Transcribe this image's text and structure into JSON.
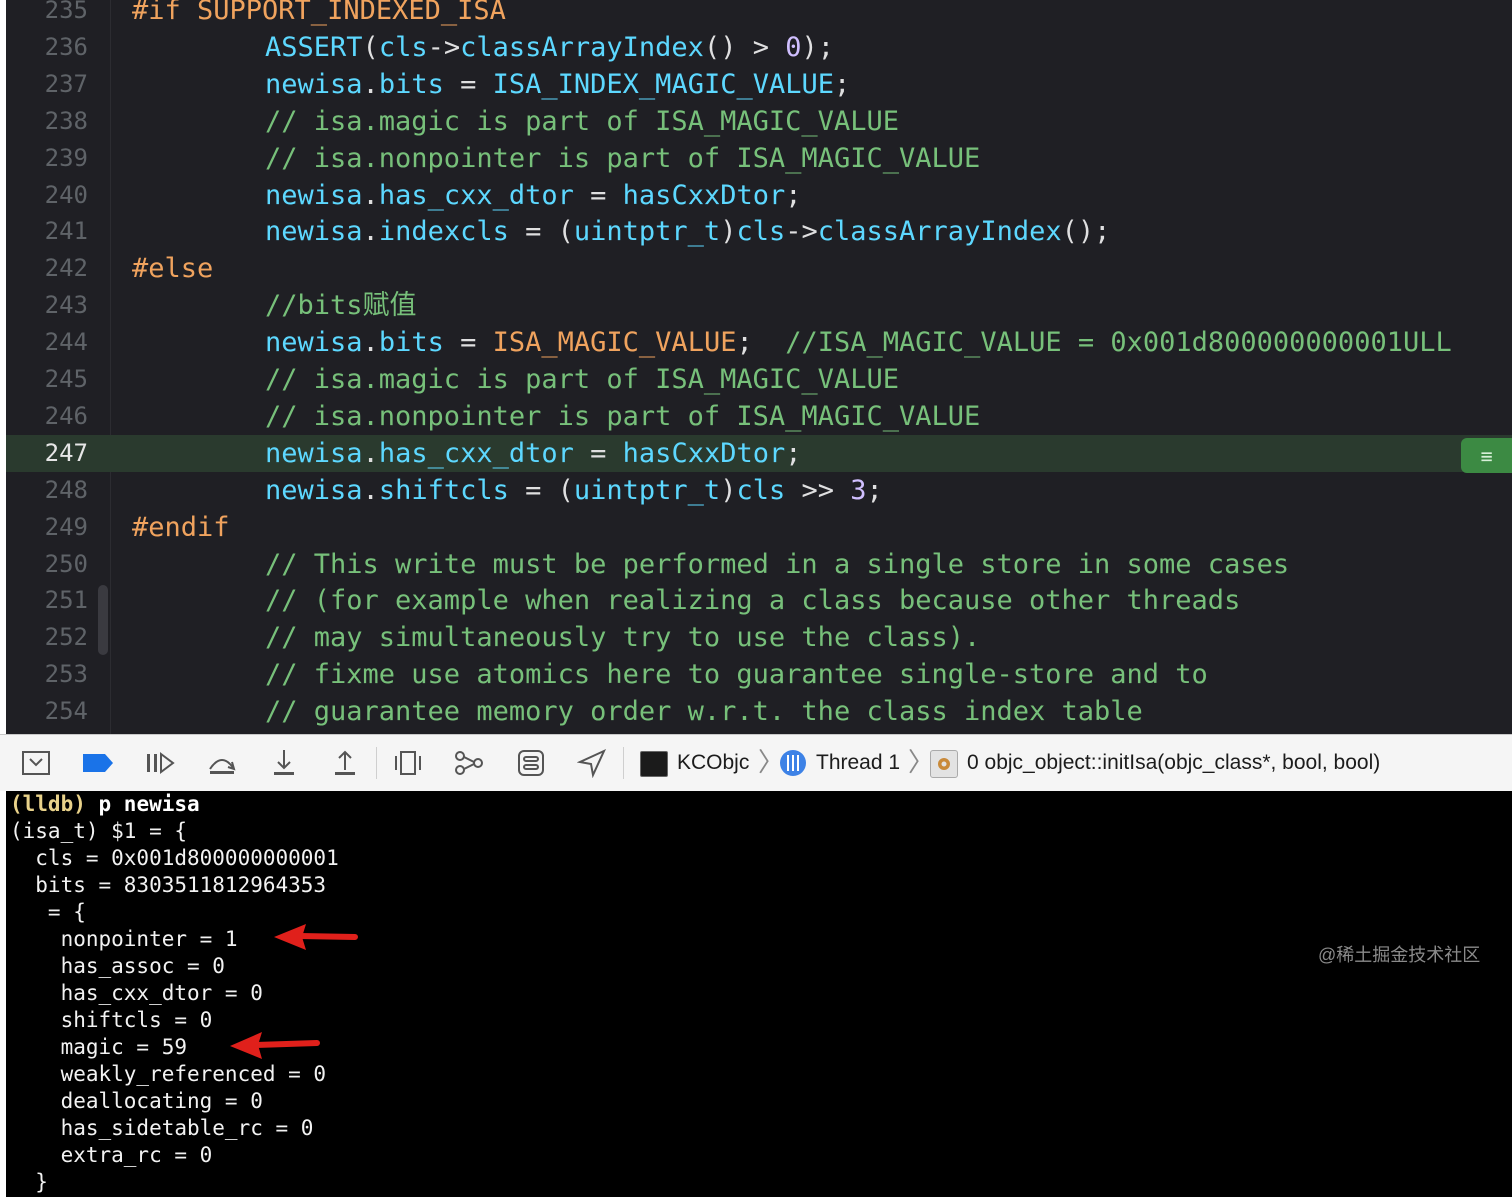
{
  "editor": {
    "lines": [
      {
        "n": "235",
        "segments": [
          {
            "t": "#if SUPPORT_INDEXED_ISA",
            "c": "pp"
          }
        ],
        "indent": 0
      },
      {
        "n": "236",
        "segments": [
          {
            "t": "ASSERT",
            "c": "id"
          },
          {
            "t": "(",
            "c": "op"
          },
          {
            "t": "cls",
            "c": "id"
          },
          {
            "t": "->",
            "c": "op"
          },
          {
            "t": "classArrayIndex",
            "c": "id"
          },
          {
            "t": "() > ",
            "c": "op"
          },
          {
            "t": "0",
            "c": "num"
          },
          {
            "t": ");",
            "c": "op"
          }
        ],
        "indent": 1
      },
      {
        "n": "237",
        "segments": [
          {
            "t": "newisa",
            "c": "id"
          },
          {
            "t": ".",
            "c": "op"
          },
          {
            "t": "bits",
            "c": "id"
          },
          {
            "t": " = ",
            "c": "op"
          },
          {
            "t": "ISA_INDEX_MAGIC_VALUE",
            "c": "id"
          },
          {
            "t": ";",
            "c": "op"
          }
        ],
        "indent": 1
      },
      {
        "n": "238",
        "segments": [
          {
            "t": "// isa.magic is part of ISA_MAGIC_VALUE",
            "c": "cm"
          }
        ],
        "indent": 1
      },
      {
        "n": "239",
        "segments": [
          {
            "t": "// isa.nonpointer is part of ISA_MAGIC_VALUE",
            "c": "cm"
          }
        ],
        "indent": 1
      },
      {
        "n": "240",
        "segments": [
          {
            "t": "newisa",
            "c": "id"
          },
          {
            "t": ".",
            "c": "op"
          },
          {
            "t": "has_cxx_dtor",
            "c": "id"
          },
          {
            "t": " = ",
            "c": "op"
          },
          {
            "t": "hasCxxDtor",
            "c": "id"
          },
          {
            "t": ";",
            "c": "op"
          }
        ],
        "indent": 1
      },
      {
        "n": "241",
        "segments": [
          {
            "t": "newisa",
            "c": "id"
          },
          {
            "t": ".",
            "c": "op"
          },
          {
            "t": "indexcls",
            "c": "id"
          },
          {
            "t": " = (",
            "c": "op"
          },
          {
            "t": "uintptr_t",
            "c": "id"
          },
          {
            "t": ")",
            "c": "op"
          },
          {
            "t": "cls",
            "c": "id"
          },
          {
            "t": "->",
            "c": "op"
          },
          {
            "t": "classArrayIndex",
            "c": "id"
          },
          {
            "t": "();",
            "c": "op"
          }
        ],
        "indent": 1
      },
      {
        "n": "242",
        "segments": [
          {
            "t": "#else",
            "c": "pp"
          }
        ],
        "indent": 0
      },
      {
        "n": "243",
        "segments": [
          {
            "t": "//bits赋值",
            "c": "cm"
          }
        ],
        "indent": 1
      },
      {
        "n": "244",
        "segments": [
          {
            "t": "newisa",
            "c": "id"
          },
          {
            "t": ".",
            "c": "op"
          },
          {
            "t": "bits",
            "c": "id"
          },
          {
            "t": " = ",
            "c": "op"
          },
          {
            "t": "ISA_MAGIC_VALUE",
            "c": "mac"
          },
          {
            "t": ";  ",
            "c": "op"
          },
          {
            "t": "//ISA_MAGIC_VALUE = 0x001d800000000001ULL",
            "c": "cmr"
          }
        ],
        "indent": 1
      },
      {
        "n": "245",
        "segments": [
          {
            "t": "// isa.magic is part of ISA_MAGIC_VALUE",
            "c": "cm"
          }
        ],
        "indent": 1
      },
      {
        "n": "246",
        "segments": [
          {
            "t": "// isa.nonpointer is part of ISA_MAGIC_VALUE",
            "c": "cm"
          }
        ],
        "indent": 1
      },
      {
        "n": "247",
        "segments": [
          {
            "t": "newisa",
            "c": "id"
          },
          {
            "t": ".",
            "c": "op"
          },
          {
            "t": "has_cxx_dtor",
            "c": "id"
          },
          {
            "t": " = ",
            "c": "op"
          },
          {
            "t": "hasCxxDtor",
            "c": "id"
          },
          {
            "t": ";",
            "c": "op"
          }
        ],
        "indent": 1,
        "current": true
      },
      {
        "n": "248",
        "segments": [
          {
            "t": "newisa",
            "c": "id"
          },
          {
            "t": ".",
            "c": "op"
          },
          {
            "t": "shiftcls",
            "c": "id"
          },
          {
            "t": " = (",
            "c": "op"
          },
          {
            "t": "uintptr_t",
            "c": "id"
          },
          {
            "t": ")",
            "c": "op"
          },
          {
            "t": "cls",
            "c": "id"
          },
          {
            "t": " >> ",
            "c": "op"
          },
          {
            "t": "3",
            "c": "num"
          },
          {
            "t": ";",
            "c": "op"
          }
        ],
        "indent": 1
      },
      {
        "n": "249",
        "segments": [
          {
            "t": "#endif",
            "c": "pp"
          }
        ],
        "indent": 0
      },
      {
        "n": "250",
        "segments": [
          {
            "t": "// This write must be performed in a single store in some cases",
            "c": "cm"
          }
        ],
        "indent": 1
      },
      {
        "n": "251",
        "segments": [
          {
            "t": "// (for example when realizing a class because other threads",
            "c": "cm"
          }
        ],
        "indent": 1
      },
      {
        "n": "252",
        "segments": [
          {
            "t": "// may simultaneously try to use the class).",
            "c": "cm"
          }
        ],
        "indent": 1
      },
      {
        "n": "253",
        "segments": [
          {
            "t": "// fixme use atomics here to guarantee single-store and to",
            "c": "cm"
          }
        ],
        "indent": 1
      },
      {
        "n": "254",
        "segments": [
          {
            "t": "// guarantee memory order w.r.t. the class index table",
            "c": "cm"
          }
        ],
        "indent": 1
      }
    ],
    "colors": {
      "pp": "#f0a35e",
      "comment": "#77c07a",
      "identifier": "#5dd8ff",
      "number": "#d0bfff",
      "current_line": "#2a3a2e"
    }
  },
  "toolbar": {
    "buttons": [
      "hide-debug-area-icon",
      "breakpoints-toggle-icon",
      "continue-icon",
      "step-over-icon",
      "step-into-icon",
      "step-out-icon",
      "view-hierarchy-icon",
      "memory-graph-icon",
      "environment-overrides-icon",
      "simulate-location-icon"
    ],
    "breadcrumb": {
      "target": "KCObjc",
      "thread": "Thread 1",
      "frame": "0 objc_object::initIsa(objc_class*, bool, bool)"
    }
  },
  "console": {
    "prompt": "(lldb)",
    "command": "p newisa",
    "output": [
      "(isa_t) $1 = {",
      "  cls = 0x001d800000000001",
      "  bits = 8303511812964353",
      "   = {",
      "    nonpointer = 1",
      "    has_assoc = 0",
      "    has_cxx_dtor = 0",
      "    shiftcls = 0",
      "    magic = 59",
      "    weakly_referenced = 0",
      "    deallocating = 0",
      "    has_sidetable_rc = 0",
      "    extra_rc = 0",
      "  }"
    ],
    "watermark": "@稀土掘金技术社区"
  }
}
